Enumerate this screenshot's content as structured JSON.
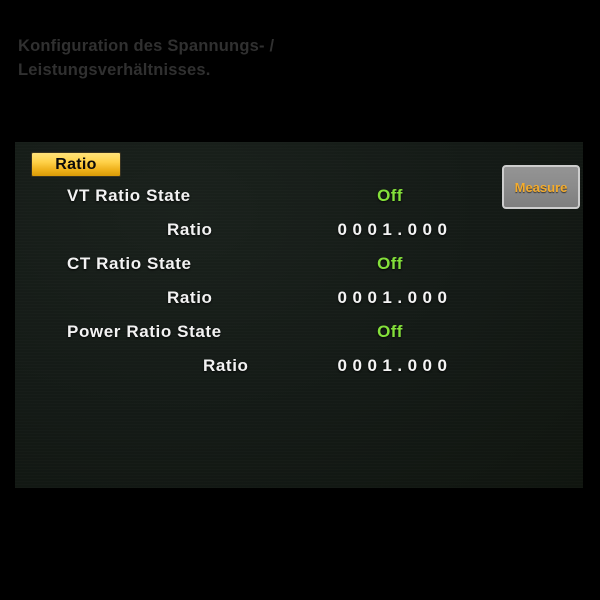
{
  "caption": {
    "text": "Konfiguration des  Spannungs- /\nLeistungsverhältnisses."
  },
  "panel": {
    "title_badge": "Ratio",
    "measure_button": "Measure",
    "background_color": "#141a16",
    "accent_color": "#ffd24a",
    "state_color": "#84e03a",
    "value_color": "#f4f4f4",
    "button_text_color": "#f4ac2e",
    "rows": [
      {
        "label": "VT  Ratio  State",
        "value": "Off",
        "value_type": "state",
        "indent": "main"
      },
      {
        "label": "Ratio",
        "value": "0001.000",
        "value_type": "number",
        "indent": "sub"
      },
      {
        "label": "CT  Ratio  State",
        "value": "Off",
        "value_type": "state",
        "indent": "main"
      },
      {
        "label": "Ratio",
        "value": "0001.000",
        "value_type": "number",
        "indent": "sub"
      },
      {
        "label": "Power  Ratio  State",
        "value": "Off",
        "value_type": "state",
        "indent": "main"
      },
      {
        "label": "Ratio",
        "value": "0001.000",
        "value_type": "number",
        "indent": "sub2"
      }
    ]
  }
}
